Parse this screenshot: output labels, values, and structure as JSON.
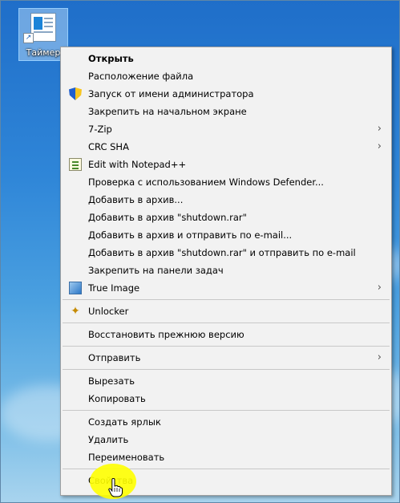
{
  "desktop": {
    "icon_label": "Таймер"
  },
  "menu": {
    "groups": [
      [
        {
          "label": "Открыть",
          "bold": true
        },
        {
          "label": "Расположение файла"
        },
        {
          "label": "Запуск от имени администратора",
          "icon": "uac-shield-icon"
        },
        {
          "label": "Закрепить на начальном экране"
        },
        {
          "label": "7-Zip",
          "submenu": true
        },
        {
          "label": "CRC SHA",
          "submenu": true
        },
        {
          "label": "Edit with Notepad++",
          "icon": "notepad-plus-plus-icon"
        },
        {
          "label": "Проверка с использованием Windows Defender..."
        },
        {
          "label": "Добавить в архив...",
          "icon": "winrar-icon"
        },
        {
          "label": "Добавить в архив \"shutdown.rar\"",
          "icon": "winrar-icon"
        },
        {
          "label": "Добавить в архив и отправить по e-mail...",
          "icon": "winrar-icon"
        },
        {
          "label": "Добавить в архив \"shutdown.rar\" и отправить по e-mail",
          "icon": "winrar-icon"
        },
        {
          "label": "Закрепить на панели задач"
        },
        {
          "label": "True Image",
          "icon": "true-image-icon",
          "submenu": true
        }
      ],
      [
        {
          "label": "Unlocker",
          "icon": "unlocker-wand-icon"
        }
      ],
      [
        {
          "label": "Восстановить прежнюю версию"
        }
      ],
      [
        {
          "label": "Отправить",
          "submenu": true
        }
      ],
      [
        {
          "label": "Вырезать"
        },
        {
          "label": "Копировать"
        }
      ],
      [
        {
          "label": "Создать ярлык"
        },
        {
          "label": "Удалить"
        },
        {
          "label": "Переименовать"
        }
      ],
      [
        {
          "label": "Свойства",
          "highlighted": true
        }
      ]
    ]
  },
  "colors": {
    "highlight": "#ffff00",
    "menu_bg": "#f2f2f2"
  }
}
